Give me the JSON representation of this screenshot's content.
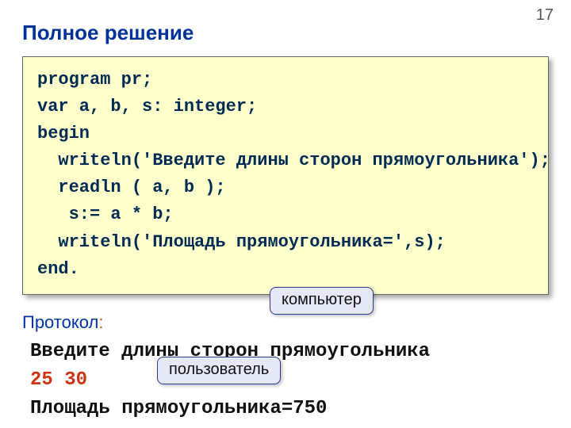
{
  "page_number": "17",
  "title": "Полное решение",
  "code": {
    "l1": "program pr;",
    "l2": "var a, b, s: integer;",
    "l3": "begin",
    "l4": "  writeln('Введите длины сторон прямоугольника');",
    "l5": "  readln ( a, b );",
    "l6": "   s:= a * b;",
    "l7": "  writeln('Площадь прямоугольника=',s);",
    "l8": "end."
  },
  "protocol": {
    "label": "Протокол",
    "prompt_line": " Введите длины сторон прямоугольника",
    "user_line": " 25 30",
    "result_line": " Площадь прямоугольника=750"
  },
  "callouts": {
    "computer": "компьютер",
    "user": "пользователь"
  }
}
